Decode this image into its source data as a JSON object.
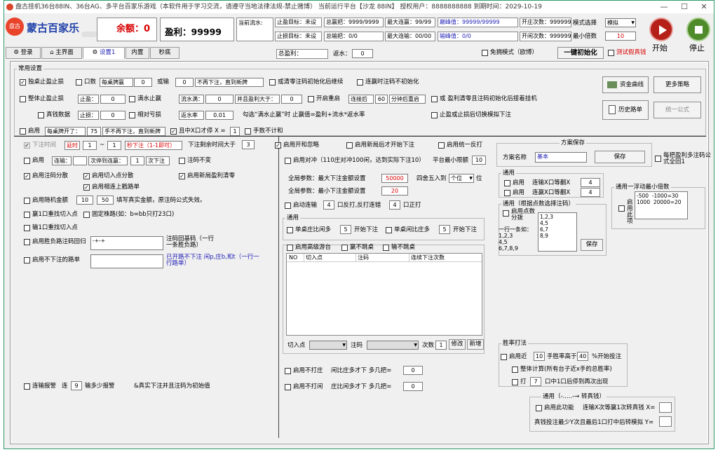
{
  "title": "盘古挂机36台88IN、36台AG、多平台百家乐游戏（本软件用于学习交流，请遵守当地法律法规-禁止赌博） 当前运行平台【沙龙 88IN】 授权用户：8888888888 到期时间：2029-10-19",
  "window": {
    "min": "—",
    "max": "☐",
    "close": "✕"
  },
  "brand": {
    "logo_text": "盘古",
    "name": "蒙古百家乐"
  },
  "header": {
    "balance_label": "余额：0",
    "profit_label": "盈利：99999",
    "current_flow_label": "当前流水:",
    "stop_profit_target": "止盈目标：未设",
    "stop_loss_target": "止损目标：未设",
    "total_win_label": "总赢把：9999/9999",
    "total_lose_label": "总输把：0/0",
    "max_win_streak": "最大连赢：99/99",
    "max_lose_streak": "最大连输：00/00",
    "peak_value": "巅峰值：99999/99999",
    "lose_value": "输峰值：0/0",
    "open_count": "开庄次数：999999",
    "open_idle_count": "开闲次数：999999",
    "mode_label": "模式选择",
    "mode_value": "模拟",
    "min_multiple_label": "最小倍数",
    "min_multiple_value": "10",
    "start_label": "开始",
    "stop_label": "停止",
    "total_profit_label": "总盈利：",
    "rebate_label": "返水：",
    "rebate_value": "0",
    "free_mode_label": "免拥模式（欧博）",
    "init_button": "一键初始化",
    "test_fake_label": "测试假真钱"
  },
  "tabs": [
    "登录",
    "主界面",
    "设置1",
    "内置",
    "秒底"
  ],
  "section_common": "常用设置",
  "row1": {
    "c1": "独桌止盈止损",
    "c2": "口数",
    "i1": "每桌牌赢",
    "v1": "0",
    "t1": "或输",
    "v2": "0",
    "t2": "不再下注，直到新牌",
    "c3": "或清零注码初始化后继续",
    "c4": "连赢时注码不初始化"
  },
  "row2": {
    "c1": "整体止盈止损",
    "t1": "止盈：",
    "v1": "0",
    "c2": "满水止赢",
    "t2": "流水满：",
    "v2": "0",
    "t3": "并且盈利大于：",
    "v3": "0",
    "c3": "开启重启",
    "t4": "连接后",
    "v4": "60",
    "t5": "分钟后重启",
    "c4": "或 盈利清零且注码初始化后接着挂机"
  },
  "row3": {
    "c1": "真钱数据",
    "t1": "止损：",
    "v1": "0",
    "c2": "相对亏损",
    "t2": "返水率",
    "v2": "0.01",
    "t3": "勾选“满水止赢”时 止赢值=盈利+流水*返水率",
    "c3": "止盈或止损后切换模拟下注"
  },
  "row4": {
    "c1": "启用",
    "t1": "每桌牌开了：",
    "v1": "75",
    "t2": "手不再下注，直到新牌",
    "c2": "且中X口才停 X =",
    "v2": "1",
    "c3": "手数不计和"
  },
  "side_buttons": {
    "fund_curve": "资金曲线",
    "more_strategy": "更多策略",
    "history": "历史路单",
    "unified": "统一公式"
  },
  "left": {
    "bet_time": "下注时间",
    "delay": "延时",
    "v1": "1",
    "tilde": "~",
    "v2": "1",
    "t1": "秒下注（1-1即可）",
    "t2": "下注剩余时间大于",
    "v3": "3",
    "enable": "启用",
    "consec_lose": "连输：",
    "t3": "次停到连赢：",
    "v4": "1",
    "t4": "次下注",
    "c_zero": "注码不变",
    "c_split": "启用注码分散",
    "c_cut": "启用切入点分散",
    "c_newpeak": "启用新局盈利清零",
    "c_link": "启用相连上戳路单",
    "c_rand": "启用随机金额",
    "rv1": "10",
    "rv2": "50",
    "rand_note": "填写真实金额，原注码公式失效。",
    "c_win1": "赢1口重找切入点",
    "c_fixed": "固定株路(如：b=bb只打23口)",
    "c_lose1": "输1口重找切入点",
    "c_winlose": "启用胜负路注码回归",
    "wl_value": "-+-+",
    "wl_note": "注码回基码（一行一条胜负路）",
    "c_nobet": "启用不下注的路单",
    "nobet_note": "已开路不下注 闲p,庄b,和t（一行一行路单）",
    "c_alarm": "连输报警",
    "alarm_t1": "连",
    "alarm_v": "9",
    "alarm_t2": "输多少报警",
    "alarm_note": "&真实下注并且注码为初始值"
  },
  "mid": {
    "c_open": "启用开和忽略",
    "c_newround": "启用新局后才开始下注",
    "c_unified": "启用统一反打",
    "c_hedge": "启用对冲（110庄对冲100闲，达到实际下注10）",
    "min_limit_label": "平台最小限额",
    "min_limit_value": "10",
    "global_max": "全局参数：最大下注金额设置",
    "gmax_value": "50000",
    "round_label": "四舍五入到",
    "round_value": "个位",
    "round_unit": "位",
    "global_min": "全局参数：最小下注金额设置",
    "gmin_value": "20",
    "c_auto": "启动连输",
    "auto_v1": "4",
    "auto_t1": "口反打,反打连错",
    "auto_v2": "4",
    "auto_t2": "口正打",
    "general": "通用",
    "c_idle": "单桌庄比闲多",
    "idle_v": "5",
    "idle_t": "开始下注",
    "c_idle2": "单桌闲比庄多",
    "idle2_v": "5",
    "idle2_t": "开始下注",
    "c_adv": "启用高级游台",
    "c_noskip1": "赢不跳桌",
    "c_noskip2": "输不跳桌",
    "table_cols": [
      "NO",
      "切入点",
      "注码",
      "连续下注次数"
    ],
    "cut_label": "切入点",
    "bet_label": "注码",
    "count_label": "次数",
    "count_value": "1",
    "modify": "修改",
    "add": "新增",
    "c_nobank": "启用不打庄",
    "nobank_t": "闲比庄多才下 多几把=",
    "nobank_v": "0",
    "c_noidle": "启用不打闲",
    "noidle_t": "庄比闲多才下 多几把=",
    "noidle_v": "0"
  },
  "right": {
    "plan_title": "方案保存",
    "plan_name_label": "方案名称",
    "plan_name": "基本",
    "save": "保存",
    "c_each": "每把盈利多注码公式全回1",
    "general": "通用",
    "r1_c": "启用",
    "r1_t": "连输X口等翻X",
    "r1_v": "4",
    "r2_c": "启用",
    "r2_t": "连赢X口等翻X",
    "r2_v": "4",
    "float_title": "通用一浮动最小倍数",
    "float_c": "启用此项",
    "float_text": "-500  -1000=30\n1000  20000=20",
    "points_title": "通用（根据点数选择注码）",
    "points_c": "启用点数分拨",
    "points_text": "1,2,3\n4,5\n6,7\n8,9",
    "line_note": "一行一条如：\n1,2,3\n4,5\n6,7,8,9",
    "points_save": "保存",
    "rate_title": "胜率打法",
    "rate_c": "启用近",
    "rate_v1": "10",
    "rate_t1": "手胜率高于",
    "rate_v2": "40",
    "rate_t2": "%开始投注",
    "rate_c2": "整体计算(所有台子近x手的总胜率)",
    "rate_c3": "打",
    "rate_v3": "7",
    "rate_t3": "口中1口后停到再次出现",
    "real_title": "通用（-.....-→ 转真钱）",
    "real_c": "启用此功能",
    "real_t1": "连输X次等赢1次转真钱 X=",
    "real_t2": "真钱投注最少Y次且最后1口打中后转模拟 Y="
  },
  "colors": {
    "accent": "#2f9a6c",
    "red": "#d80000",
    "blue": "#1e1eb4"
  }
}
